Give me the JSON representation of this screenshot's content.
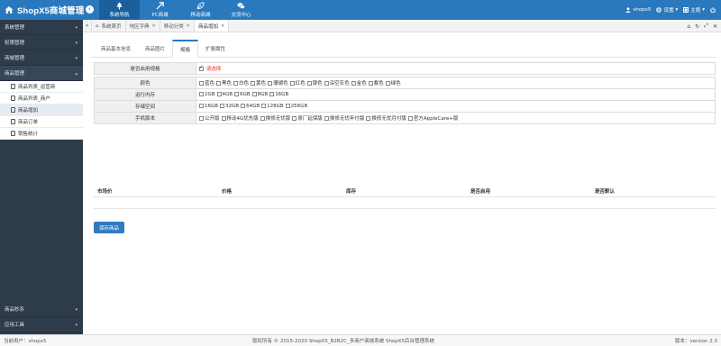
{
  "header": {
    "title": "ShopX5商城管理",
    "nav": [
      {
        "label": "系统导航",
        "icon": "tree-icon",
        "active": true
      },
      {
        "label": "PC商城",
        "icon": "arrow-icon",
        "active": false
      },
      {
        "label": "移动商城",
        "icon": "leaf-icon",
        "active": false
      },
      {
        "label": "交流中心",
        "icon": "chat-icon",
        "active": false
      }
    ],
    "user": "shopx5",
    "settings": "设置",
    "theme": "主题"
  },
  "sidebar": {
    "groups_top": [
      {
        "label": "系统管理"
      },
      {
        "label": "权限管理"
      },
      {
        "label": "商城管理"
      }
    ],
    "open_group": "商品管理",
    "sub_items": [
      {
        "label": "商品列表_运营商",
        "active": false
      },
      {
        "label": "商品列表_商户",
        "active": false
      },
      {
        "label": "商品增加",
        "active": true
      },
      {
        "label": "商品订单",
        "active": false
      },
      {
        "label": "销售统计",
        "active": false
      }
    ],
    "groups_bottom": [
      {
        "label": "商品秒杀"
      },
      {
        "label": "应用工具"
      }
    ]
  },
  "tabs": [
    {
      "label": "系统首页",
      "closable": false
    },
    {
      "label": "地区字典",
      "closable": true
    },
    {
      "label": "移动分类",
      "closable": true
    },
    {
      "label": "商品增加",
      "closable": true
    }
  ],
  "subtabs": [
    "商品基本信息",
    "商品图片",
    "规格",
    "扩展属性"
  ],
  "active_subtab": "规格",
  "spec": {
    "enable_label": "是否启用规格",
    "enable_hint": "请选择",
    "rows": [
      {
        "label": "颜色",
        "options": [
          "蓝色",
          "黑色",
          "白色",
          "黄色",
          "珊瑚色",
          "红色",
          "银色",
          "深空灰色",
          "金色",
          "紫色",
          "绿色"
        ]
      },
      {
        "label": "运行内存",
        "options": [
          "2GB",
          "4GB",
          "6GB",
          "8GB",
          "16GB"
        ]
      },
      {
        "label": "存储空间",
        "options": [
          "16GB",
          "32GB",
          "64GB",
          "128GB",
          "256GB"
        ]
      },
      {
        "label": "手机版本",
        "options": [
          "公开版",
          "移动4G优先版",
          "换修无忧版",
          "原厂延保版",
          "换修无忧年付版",
          "换修无忧月付版",
          "官方AppleCare+版"
        ]
      }
    ]
  },
  "grid_columns": [
    "市场价",
    "价格",
    "库存",
    "是否启用",
    "是否默认"
  ],
  "save_button": "保存商品",
  "footer": {
    "current_user": "当前用户：shopx5",
    "copyright": "版权所有 © 2015-2020 ShopX5_B2B2C_多商户商城系统 ShopX5后台管理系统",
    "version": "版本：version 2.3"
  }
}
